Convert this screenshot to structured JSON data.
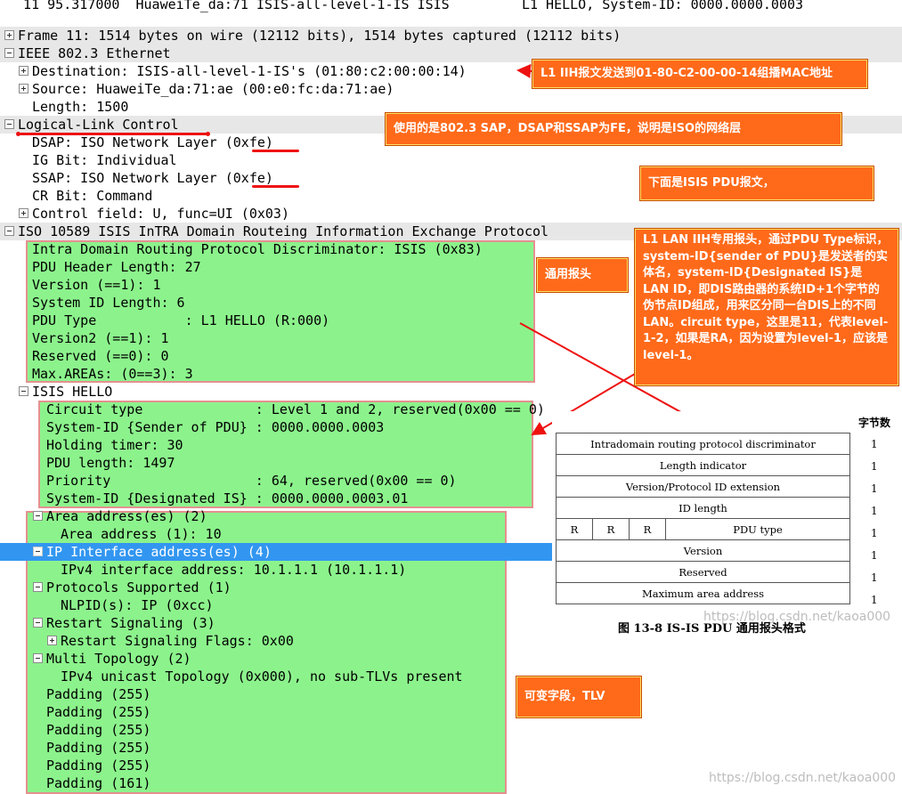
{
  "packet_row": "  11 95.317000  HuaweiTe_da:71 ISIS-all-level-1-IS ISIS         L1 HELLO, System-ID: 0000.0000.0003",
  "tree": [
    {
      "t": "Frame 11: 1514 bytes on wire (12112 bits), 1514 bytes captured (12112 bits)"
    },
    {
      "t": "IEEE 802.3 Ethernet"
    },
    {
      "t": "Destination: ISIS-all-level-1-IS's (01:80:c2:00:00:14)"
    },
    {
      "t": "Source: HuaweiTe_da:71:ae (00:e0:fc:da:71:ae)"
    },
    {
      "t": "Length: 1500"
    },
    {
      "t": "Logical-Link Control"
    },
    {
      "t": "DSAP: ISO Network Layer (0xfe)"
    },
    {
      "t": "IG Bit: Individual"
    },
    {
      "t": "SSAP: ISO Network Layer (0xfe)"
    },
    {
      "t": "CR Bit: Command"
    },
    {
      "t": "Control field: U, func=UI (0x03)"
    },
    {
      "t": "ISO 10589 ISIS InTRA Domain Routeing Information Exchange Protocol"
    },
    {
      "t": "Intra Domain Routing Protocol Discriminator: ISIS (0x83)"
    },
    {
      "t": "PDU Header Length: 27"
    },
    {
      "t": "Version (==1): 1"
    },
    {
      "t": "System ID Length: 6"
    },
    {
      "t": "PDU Type           : L1 HELLO (R:000)"
    },
    {
      "t": "Version2 (==1): 1"
    },
    {
      "t": "Reserved (==0): 0"
    },
    {
      "t": "Max.AREAs: (0==3): 3"
    },
    {
      "t": "ISIS HELLO"
    },
    {
      "t": "Circuit type              : Level 1 and 2, reserved(0x00 == 0)"
    },
    {
      "t": "System-ID {Sender of PDU} : 0000.0000.0003"
    },
    {
      "t": "Holding timer: 30"
    },
    {
      "t": "PDU length: 1497"
    },
    {
      "t": "Priority                  : 64, reserved(0x00 == 0)"
    },
    {
      "t": "System-ID {Designated IS} : 0000.0000.0003.01"
    },
    {
      "t": "Area address(es) (2)"
    },
    {
      "t": "Area address (1): 10"
    },
    {
      "t": "IP Interface address(es) (4)"
    },
    {
      "t": "IPv4 interface address: 10.1.1.1 (10.1.1.1)"
    },
    {
      "t": "Protocols Supported (1)"
    },
    {
      "t": "NLPID(s): IP (0xcc)"
    },
    {
      "t": "Restart Signaling (3)"
    },
    {
      "t": "Restart Signaling Flags: 0x00"
    },
    {
      "t": "Multi Topology (2)"
    },
    {
      "t": "IPv4 unicast Topology (0x000), no sub-TLVs present"
    },
    {
      "t": "Padding (255)"
    },
    {
      "t": "Padding (255)"
    },
    {
      "t": "Padding (255)"
    },
    {
      "t": "Padding (255)"
    },
    {
      "t": "Padding (255)"
    },
    {
      "t": "Padding (161)"
    }
  ],
  "callouts": {
    "mac": "L1 IIH报文发送到01-80-C2-00-00-14组播MAC地址",
    "sap": "使用的是802.3 SAP，DSAP和SSAP为FE，说明是ISO的网络层",
    "pdu": "下面是ISIS PDU报文，",
    "common_hdr": "通用报头",
    "lan_iih": "L1 LAN IIH专用报头，通过PDU Type标识，system-ID{sender of PDU}是发送者的实体名，system-ID{Designated IS}是 LAN ID，即DIS路由器的系统ID+1个字节的伪节点ID组成，用来区分同一台DIS上的不同LAN。circuit type，这里是11，代表level-1-2，如果是RA，因为设置为level-1，应该是level-1。",
    "tlv": "可变字段，TLV"
  },
  "figure": {
    "column_header": "字节数",
    "rows": [
      "Intradomain routing protocol discriminator",
      "Length indicator",
      "Version/Protocol ID extension",
      "ID length",
      "PDU type",
      "Version",
      "Reserved",
      "Maximum area address"
    ],
    "r_label": "R",
    "byte_value": "1",
    "caption": "图 13-8   IS-IS PDU 通用报头格式"
  },
  "watermarks": {
    "fig": "https://blog.csdn.net/kaoa000",
    "page": "https://blog.csdn.net/kaoa000"
  },
  "colors": {
    "highlight_green": "#60ee60",
    "callout_orange": "#ff6a1a",
    "selection_blue": "#3296f0"
  }
}
